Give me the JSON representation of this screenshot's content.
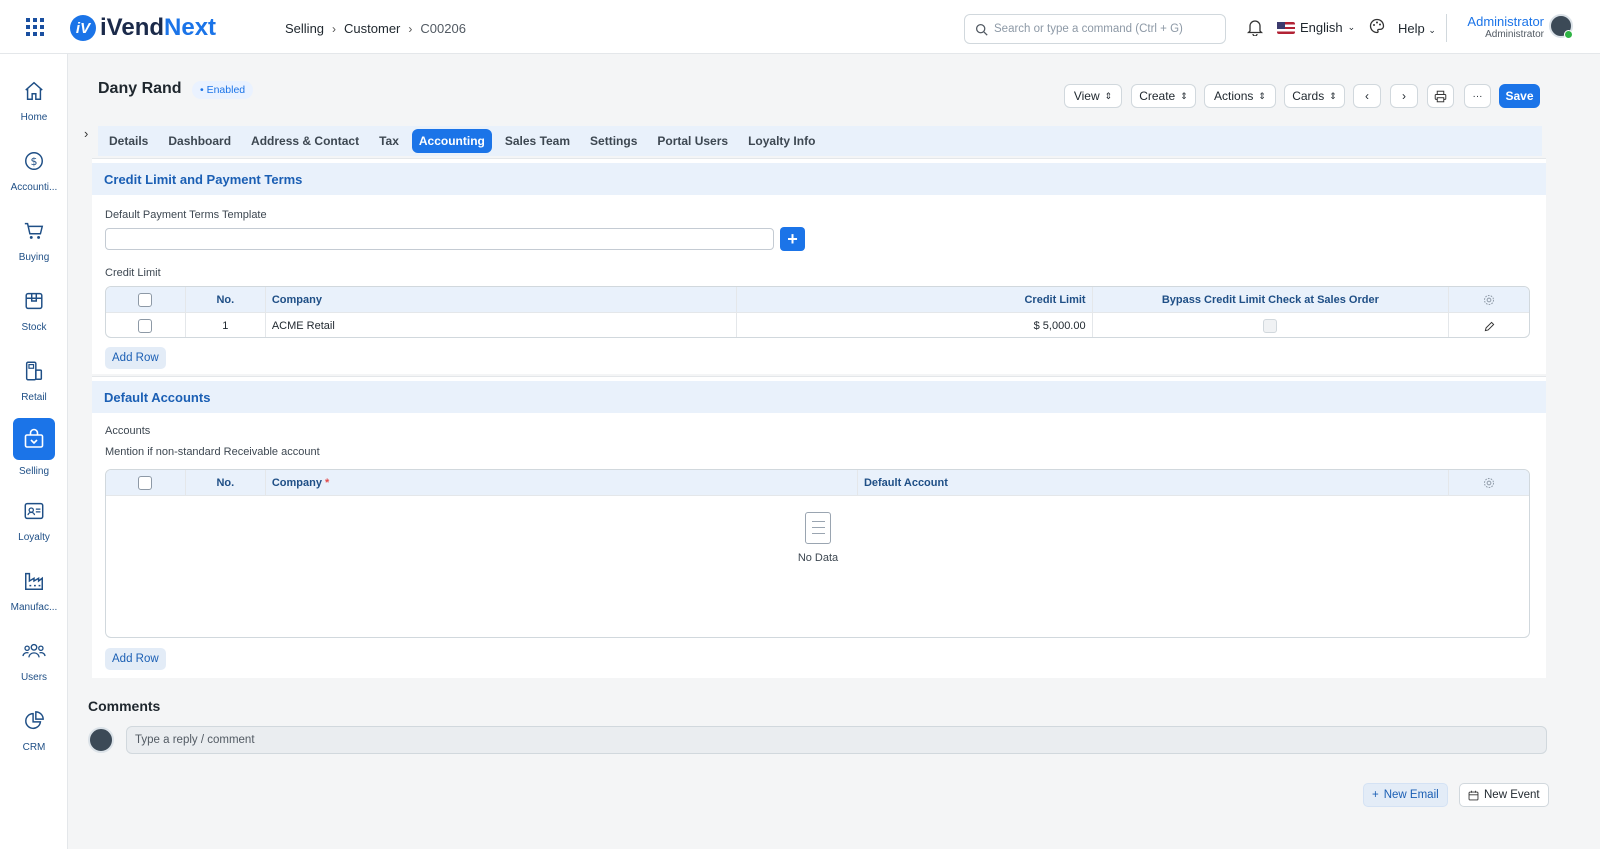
{
  "app": {
    "name_part1": "iVend",
    "name_part2": "Next",
    "logo_mark": "iV"
  },
  "breadcrumb": [
    "Selling",
    "Customer",
    "C00206"
  ],
  "search": {
    "placeholder": "Search or type a command (Ctrl + G)"
  },
  "header": {
    "language": "English",
    "help": "Help",
    "user_name": "Administrator",
    "user_role": "Administrator"
  },
  "sidebar": {
    "items": [
      {
        "label": "Home",
        "icon": "home-icon"
      },
      {
        "label": "Accounti...",
        "icon": "dollar-icon"
      },
      {
        "label": "Buying",
        "icon": "cart-icon"
      },
      {
        "label": "Stock",
        "icon": "box-icon"
      },
      {
        "label": "Retail",
        "icon": "pos-icon"
      },
      {
        "label": "Selling",
        "icon": "bag-icon",
        "active": true
      },
      {
        "label": "Loyalty",
        "icon": "card-icon"
      },
      {
        "label": "Manufac...",
        "icon": "factory-icon"
      },
      {
        "label": "Users",
        "icon": "users-icon"
      },
      {
        "label": "CRM",
        "icon": "pie-icon"
      }
    ]
  },
  "doc": {
    "title": "Dany Rand",
    "status": "Enabled"
  },
  "toolbar": {
    "view": "View",
    "create": "Create",
    "actions": "Actions",
    "cards": "Cards",
    "save": "Save",
    "more": "···"
  },
  "tabs": [
    "Details",
    "Dashboard",
    "Address & Contact",
    "Tax",
    "Accounting",
    "Sales Team",
    "Settings",
    "Portal Users",
    "Loyalty Info"
  ],
  "active_tab": "Accounting",
  "credit_section": {
    "title": "Credit Limit and Payment Terms",
    "payment_terms_label": "Default Payment Terms Template",
    "payment_terms_value": "",
    "credit_limit_label": "Credit Limit",
    "columns": [
      "No.",
      "Company",
      "Credit Limit",
      "Bypass Credit Limit Check at Sales Order"
    ],
    "rows": [
      {
        "no": "1",
        "company": "ACME Retail",
        "credit_limit": "$ 5,000.00",
        "bypass": false
      }
    ],
    "add_row": "Add Row"
  },
  "accounts_section": {
    "title": "Default Accounts",
    "accounts_label": "Accounts",
    "accounts_desc": "Mention if non-standard Receivable account",
    "columns": [
      "No.",
      "Company",
      "Default Account"
    ],
    "required_mark": "*",
    "empty_text": "No Data",
    "add_row": "Add Row"
  },
  "comments": {
    "title": "Comments",
    "placeholder": "Type a reply / comment"
  },
  "footer_actions": {
    "new_email": "New Email",
    "new_event": "New Event"
  }
}
